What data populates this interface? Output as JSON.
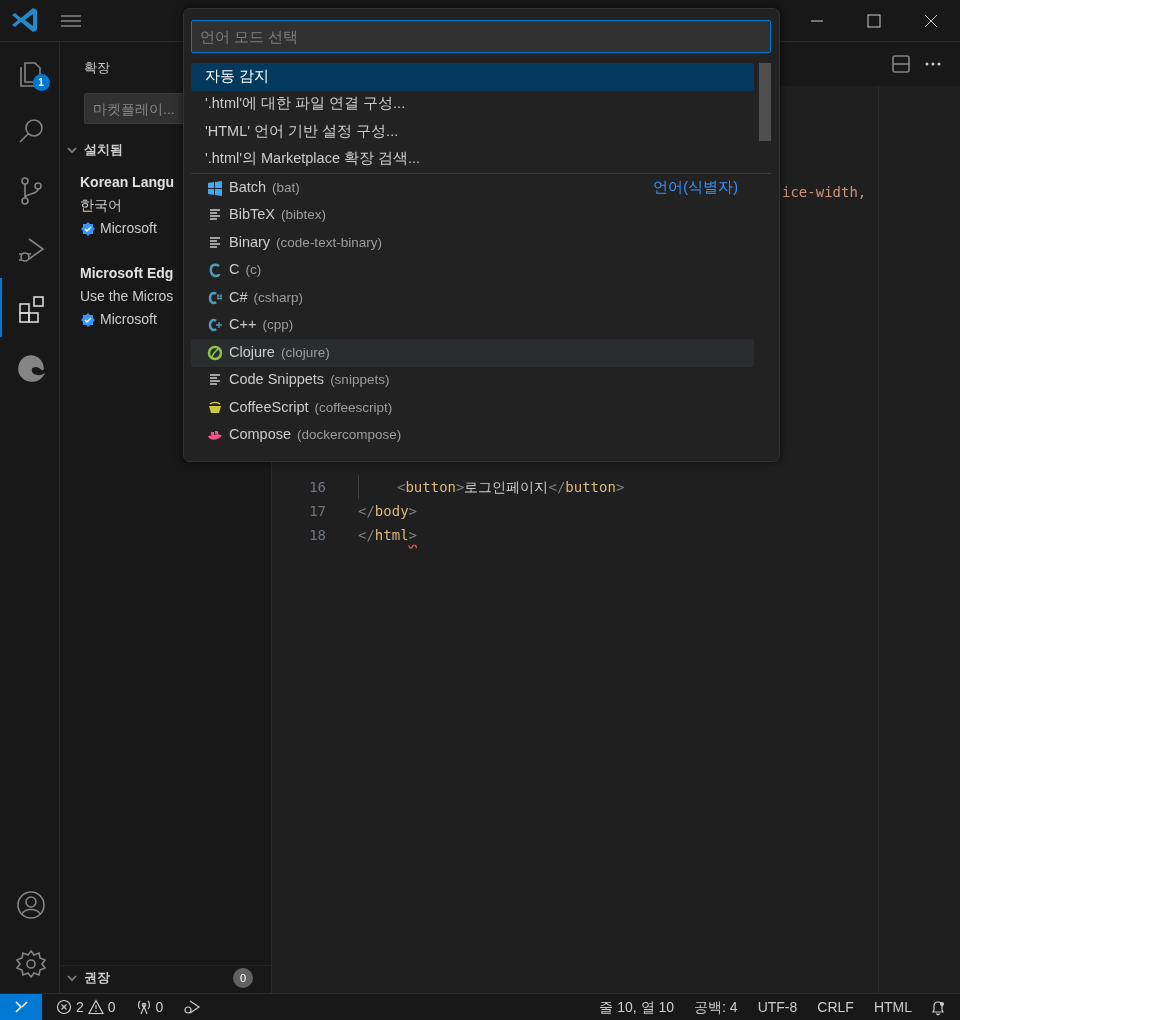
{
  "activity_bar": {
    "items": [
      {
        "kind": "files",
        "selected": false,
        "badge": "1"
      },
      {
        "kind": "search",
        "selected": false
      },
      {
        "kind": "branch",
        "selected": false
      },
      {
        "kind": "run",
        "selected": false
      },
      {
        "kind": "extensions",
        "selected": true
      },
      {
        "kind": "edge",
        "selected": false
      }
    ],
    "bottom_items": [
      {
        "kind": "account"
      },
      {
        "kind": "settings"
      }
    ]
  },
  "sidebar": {
    "title": "확장",
    "search": {
      "placeholder": "마켓플레이..."
    },
    "sections": [
      {
        "title": "설치됨",
        "expanded": true,
        "extensions": [
          {
            "name": "Korean Langu",
            "description": "한국어",
            "publisher": "Microsoft",
            "verified": true
          },
          {
            "name": "Microsoft Edg",
            "description": "Use the Micros",
            "publisher": "Microsoft",
            "verified": true
          }
        ]
      },
      {
        "title": "권장",
        "expanded": true,
        "count": "0"
      }
    ]
  },
  "editor": {
    "visible_fragment": "ice-width,",
    "lines": [
      {
        "number": "16",
        "indent": true,
        "tokens": [
          {
            "text": "<",
            "kind": "punct"
          },
          {
            "text": "button",
            "kind": "tag"
          },
          {
            "text": ">",
            "kind": "punct"
          },
          {
            "text": "로그인페이지",
            "kind": "text"
          },
          {
            "text": "</",
            "kind": "punct"
          },
          {
            "text": "button",
            "kind": "tag"
          },
          {
            "text": ">",
            "kind": "punct"
          }
        ]
      },
      {
        "number": "17",
        "indent": false,
        "tokens": [
          {
            "text": "</",
            "kind": "punct"
          },
          {
            "text": "body",
            "kind": "tag"
          },
          {
            "text": ">",
            "kind": "punct"
          }
        ]
      },
      {
        "number": "18",
        "indent": false,
        "tokens": [
          {
            "text": "</",
            "kind": "punct"
          },
          {
            "text": "html",
            "kind": "tag"
          },
          {
            "text": ">",
            "kind": "punct",
            "error": true
          }
        ]
      }
    ]
  },
  "quick_pick": {
    "placeholder": "언어 모드 선택",
    "items": [
      {
        "kind": "action",
        "label": "자동 감지",
        "selected": true,
        "hovered": false
      },
      {
        "kind": "action",
        "label": "'.html'에 대한 파일 연결 구성...",
        "selected": false,
        "hovered": false
      },
      {
        "kind": "action",
        "label": "'HTML' 언어 기반 설정 구성...",
        "selected": false,
        "hovered": false
      },
      {
        "kind": "action",
        "label": "'.html'의 Marketplace 확장 검색...",
        "selected": false,
        "hovered": false
      },
      {
        "kind": "windows",
        "label": "Batch",
        "id": "(bat)",
        "group_label": "언어(식별자)",
        "selected": false,
        "hovered": false
      },
      {
        "kind": "lines",
        "label": "BibTeX",
        "id": "(bibtex)",
        "selected": false,
        "hovered": false
      },
      {
        "kind": "lines",
        "label": "Binary",
        "id": "(code-text-binary)",
        "selected": false,
        "hovered": false
      },
      {
        "kind": "c",
        "label": "C",
        "id": "(c)",
        "selected": false,
        "hovered": false
      },
      {
        "kind": "csharp",
        "label": "C#",
        "id": "(csharp)",
        "selected": false,
        "hovered": false
      },
      {
        "kind": "cpp",
        "label": "C++",
        "id": "(cpp)",
        "selected": false,
        "hovered": false
      },
      {
        "kind": "clojure",
        "label": "Clojure",
        "id": "(clojure)",
        "selected": false,
        "hovered": true
      },
      {
        "kind": "lines",
        "label": "Code Snippets",
        "id": "(snippets)",
        "selected": false,
        "hovered": false
      },
      {
        "kind": "cup",
        "label": "CoffeeScript",
        "id": "(coffeescript)",
        "selected": false,
        "hovered": false
      },
      {
        "kind": "whale",
        "label": "Compose",
        "id": "(dockercompose)",
        "selected": false,
        "hovered": false
      }
    ]
  },
  "status_bar": {
    "errors": "2",
    "warnings": "0",
    "ports": "0",
    "right": [
      "줄 10, 열 10",
      "공백: 4",
      "UTF-8",
      "CRLF",
      "HTML"
    ]
  }
}
